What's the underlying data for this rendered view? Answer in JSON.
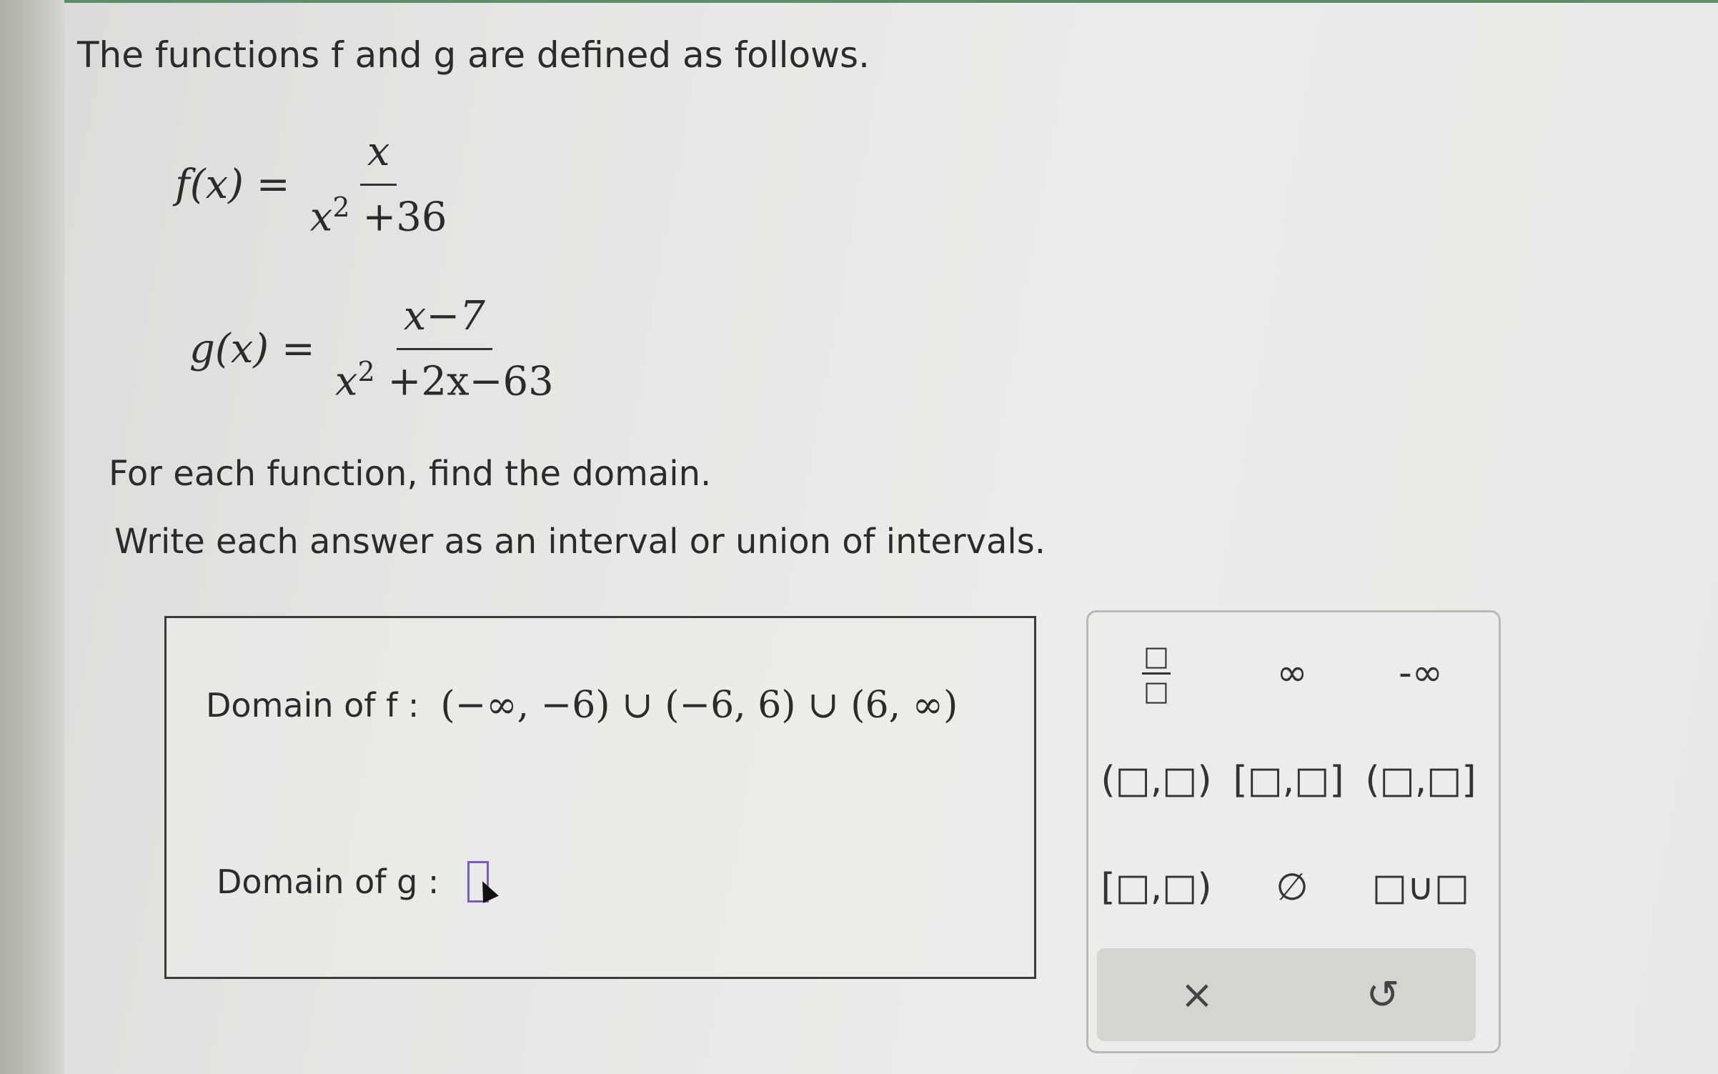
{
  "question": {
    "intro": "The functions f and g are defined as follows.",
    "f": {
      "lhs": "f(x) =",
      "numerator": "x",
      "denominator_base": "x",
      "denominator_exp": "2",
      "denominator_rest": "+36"
    },
    "g": {
      "lhs": "g(x) =",
      "numerator": "x−7",
      "denominator_base": "x",
      "denominator_exp": "2",
      "denominator_rest": "+2x−63"
    },
    "prompt1": "For each function, find the domain.",
    "prompt2": "Write each answer as an interval or union of intervals."
  },
  "answers": {
    "f_label": "Domain of f :",
    "f_value": "(−∞, −6) ∪ (−6, 6) ∪ (6, ∞)",
    "g_label": "Domain of g :",
    "g_value": ""
  },
  "keypad": {
    "keys": {
      "fraction_top": "□",
      "fraction_bottom": "□",
      "infinity": "∞",
      "neg_infinity": "-∞",
      "open_open": "(□,□)",
      "closed_closed": "[□,□]",
      "open_closed": "(□,□]",
      "closed_open": "[□,□)",
      "empty_set": "∅",
      "union": "□∪□"
    },
    "actions": {
      "clear": "×",
      "undo": "↺"
    }
  }
}
